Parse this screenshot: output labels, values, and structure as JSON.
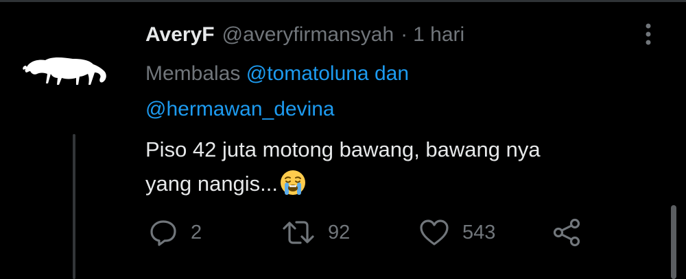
{
  "tweet": {
    "display_name": "AveryF",
    "handle": "@averyfirmansyah",
    "separator": "·",
    "time": "1 hari",
    "replying_prefix": "Membalas",
    "mention_1": "@tomatoluna",
    "replying_joiner": "dan",
    "mention_2": "@hermawan_devina",
    "text_line_1": "Piso 42 juta motong bawang, bawang nya",
    "text_line_2": "yang nangis...",
    "emoji": "loudly-crying-face"
  },
  "actions": {
    "reply_count": "2",
    "retweet_count": "92",
    "like_count": "543"
  },
  "icons": {
    "reply": "reply-icon",
    "retweet": "retweet-icon",
    "like": "heart-icon",
    "share": "share-icon",
    "more": "more-options-icon"
  },
  "colors": {
    "background": "#000000",
    "text": "#e7e9ea",
    "secondary": "#71767b",
    "link": "#1d9bf0"
  }
}
